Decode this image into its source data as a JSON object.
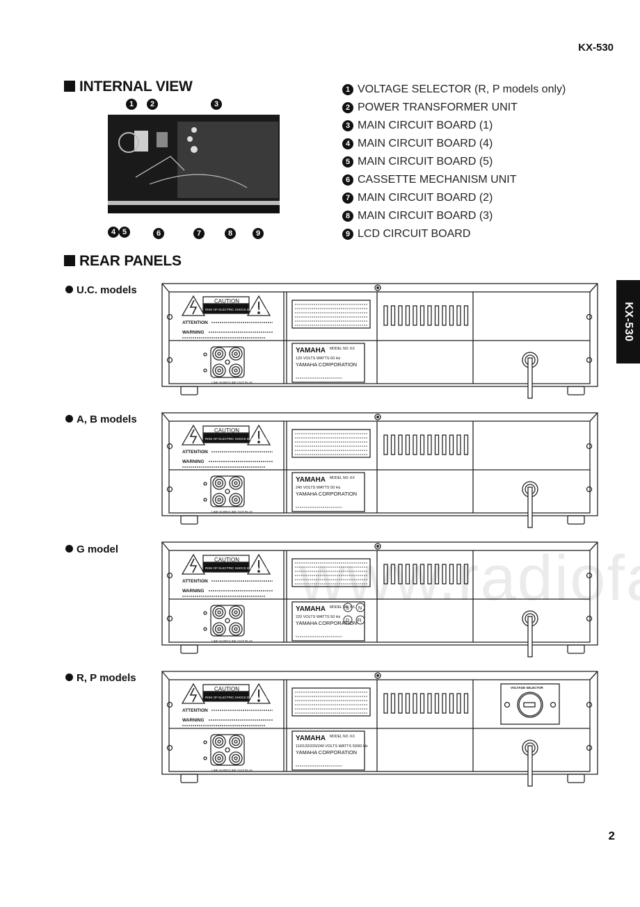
{
  "header": {
    "model_code": "KX-530"
  },
  "side_tab": {
    "label": "KX-530"
  },
  "footer": {
    "page_number": "2"
  },
  "internal_view": {
    "title": "INTERNAL VIEW",
    "callouts_top": [
      "1",
      "2",
      "3"
    ],
    "callouts_bottom": [
      "4",
      "5",
      "6",
      "7",
      "8",
      "9"
    ],
    "legend": [
      {
        "num": "1",
        "label": "VOLTAGE SELECTOR (R, P models only)"
      },
      {
        "num": "2",
        "label": "POWER TRANSFORMER UNIT"
      },
      {
        "num": "3",
        "label": "MAIN CIRCUIT BOARD (1)"
      },
      {
        "num": "4",
        "label": "MAIN CIRCUIT BOARD (4)"
      },
      {
        "num": "5",
        "label": "MAIN CIRCUIT BOARD (5)"
      },
      {
        "num": "6",
        "label": "CASSETTE MECHANISM UNIT"
      },
      {
        "num": "7",
        "label": "MAIN CIRCUIT BOARD (2)"
      },
      {
        "num": "8",
        "label": "MAIN CIRCUIT BOARD (3)"
      },
      {
        "num": "9",
        "label": "LCD CIRCUIT BOARD"
      }
    ]
  },
  "rear_panels": {
    "title": "REAR PANELS",
    "caution_label": "CAUTION",
    "caution_sub": "RISK OF ELECTRIC SHOCK DO NOT OPEN",
    "attention_label": "ATTENTION",
    "warning_label": "WARNING",
    "brand": "YAMAHA",
    "model_no_label": "MODEL NO. KX",
    "corporation": "YAMAHA CORPORATION",
    "line_in": "LINE IN REC",
    "line_out": "LINE OUT PLAY",
    "voltage_selector_label": "VOLTAGE SELECTOR",
    "models": [
      {
        "label": "U.C. models",
        "rating": "120 VOLTS   WATTS  60 Hz",
        "voltage_selector": false,
        "marks": false
      },
      {
        "label": "A, B models",
        "rating": "240 VOLTS   WATTS  50 Hz",
        "voltage_selector": false,
        "marks": false
      },
      {
        "label": "G model",
        "rating": "220 VOLTS   WATTS  50 Hz",
        "voltage_selector": false,
        "marks": true
      },
      {
        "label": "R, P models",
        "rating": "110/120/220/240 VOLTS  WATTS 50/60 Hz",
        "voltage_selector": true,
        "marks": false
      }
    ],
    "safety_marks": [
      "S",
      "N",
      "D",
      "FI"
    ]
  },
  "watermark": "www.radiofans.c"
}
